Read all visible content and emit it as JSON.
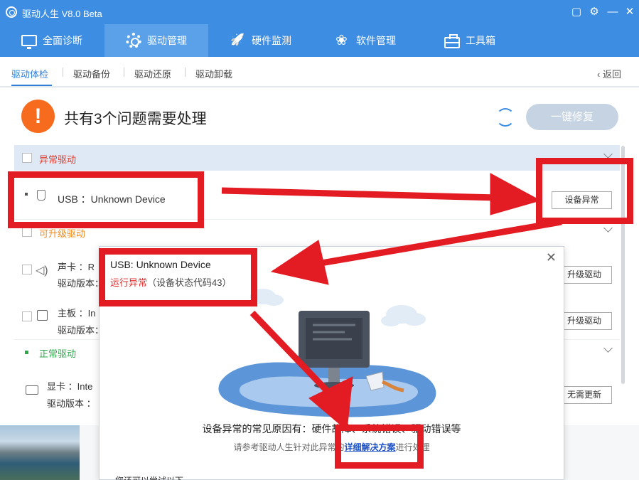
{
  "app": {
    "title": "驱动人生 V8.0 Beta"
  },
  "nav": [
    {
      "label": "全面诊断",
      "icon": "monitor-icon"
    },
    {
      "label": "驱动管理",
      "icon": "gear-icon"
    },
    {
      "label": "硬件监测",
      "icon": "rocket-icon"
    },
    {
      "label": "软件管理",
      "icon": "flower-icon"
    },
    {
      "label": "工具箱",
      "icon": "toolbox-icon"
    }
  ],
  "subtabs": [
    "驱动体检",
    "驱动备份",
    "驱动还原",
    "驱动卸载"
  ],
  "back_label": "返回",
  "header": {
    "badge": "!",
    "headline": "共有3个问题需要处理",
    "fix_button": "一键修复"
  },
  "sections": {
    "abnormal": {
      "label": "异常驱动",
      "color": "#e03a2a"
    },
    "upgradable": {
      "label": "可升级驱动",
      "color": "#f08a1c"
    },
    "normal": {
      "label": "正常驱动",
      "color": "#2ca84b"
    }
  },
  "rows": {
    "usb": {
      "name": "USB ：Unknown Device",
      "button": "设备异常"
    },
    "sound": {
      "name": "声卡 ：R",
      "version": "驱动版本：",
      "button": "升级驱动"
    },
    "board": {
      "name": "主板 ：In",
      "version": "驱动版本：",
      "button": "升级驱动"
    },
    "gpu": {
      "name": "显卡 ：Inte",
      "version": "驱动版本 ：",
      "button": "无需更新"
    }
  },
  "popup": {
    "title": "USB: Unknown Device",
    "status_error": "运行异常",
    "status_code": "（设备状态代码43）",
    "cause": "设备异常的常见原因有：硬件故障、系统错误、驱动错误等",
    "hint_before": "请参考驱动人生针对此异常的",
    "hint_link": "详细解决方案",
    "hint_after": "进行处理",
    "more": "您还可以尝试以下"
  },
  "colors": {
    "accent": "#3d8de3",
    "annotation": "#e31b23"
  }
}
